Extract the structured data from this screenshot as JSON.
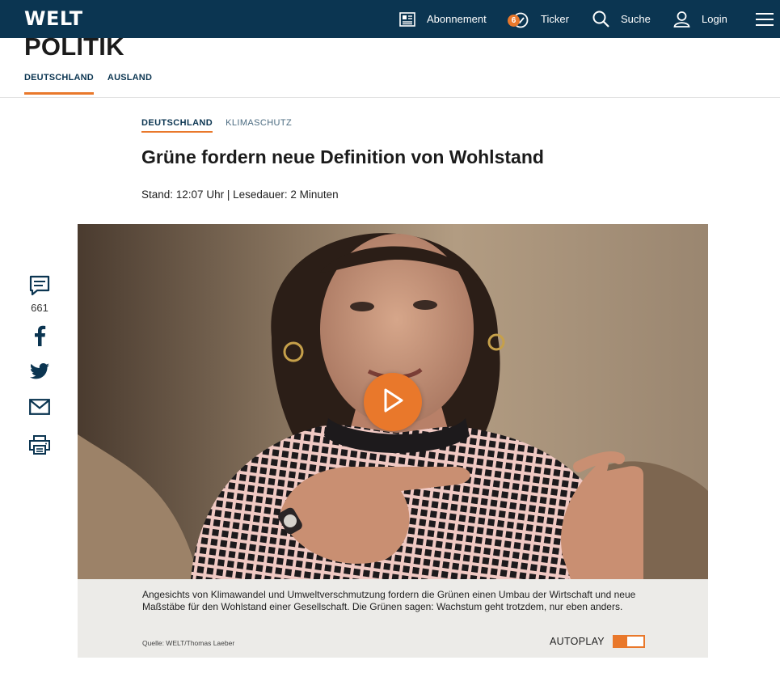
{
  "header": {
    "logo": "WELT",
    "nav": [
      {
        "label": "Abonnement",
        "icon": "newspaper-icon"
      },
      {
        "label": "Ticker",
        "icon": "clock-icon",
        "badge": "6"
      },
      {
        "label": "Suche",
        "icon": "search-icon"
      },
      {
        "label": "Login",
        "icon": "user-icon"
      }
    ],
    "menu_icon": "hamburger-menu-icon"
  },
  "section": {
    "title": "POLITIK",
    "subnav": [
      {
        "label": "DEUTSCHLAND",
        "active": true
      },
      {
        "label": "AUSLAND",
        "active": false
      }
    ]
  },
  "article": {
    "tags": [
      "DEUTSCHLAND",
      "KLIMASCHUTZ"
    ],
    "headline": "Grüne fordern neue Definition von Wohlstand",
    "meta": "Stand: 12:07 Uhr | Lesedauer: 2 Minuten"
  },
  "share": {
    "comments_count": "661",
    "icons": [
      "comment-icon",
      "facebook-icon",
      "twitter-icon",
      "mail-icon",
      "print-icon"
    ]
  },
  "video": {
    "caption": "Angesichts von Klimawandel und Umweltverschmutzung fordern die Grünen einen Umbau der Wirtschaft und neue Maßstäbe für den Wohlstand einer Gesellschaft. Die Grünen sagen: Wachstum geht trotzdem, nur eben anders.",
    "source": "Quelle: WELT/Thomas Laeber",
    "autoplay_label": "AUTOPLAY",
    "autoplay_on": true
  },
  "colors": {
    "brand_navy": "#0b3551",
    "accent_orange": "#e9782b"
  }
}
